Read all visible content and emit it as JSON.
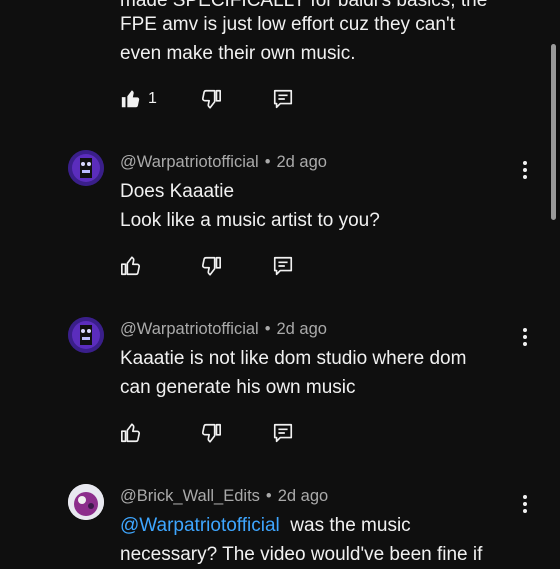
{
  "comments": [
    {
      "lines": [
        "made SPECIFICALLY for baldi's basics, the",
        "FPE amv is just low effort cuz they can't",
        "even make their own music."
      ],
      "likes": "1"
    },
    {
      "author": "@Warpatriotofficial",
      "time": "2d ago",
      "lines": [
        "Does Kaaatie",
        "Look like a music artist to you?"
      ]
    },
    {
      "author": "@Warpatriotofficial",
      "time": "2d ago",
      "lines": [
        "Kaaatie is not like dom studio where dom",
        "can generate his own music"
      ]
    },
    {
      "author": "@Brick_Wall_Edits",
      "time": "2d ago",
      "mention": "@Warpatriotofficial",
      "line1_rest": "was the music",
      "lines": [
        "necessary? The video would've been fine if"
      ]
    }
  ],
  "separator": "•",
  "icons": {
    "like": "thumb-up-icon",
    "dislike": "thumb-down-icon",
    "reply": "reply-icon",
    "menu": "more-vert-icon"
  },
  "colors": {
    "background": "#0f0f0f",
    "text": "#f1f1f1",
    "secondary": "#aaaaaa",
    "mention": "#3ea6ff"
  }
}
